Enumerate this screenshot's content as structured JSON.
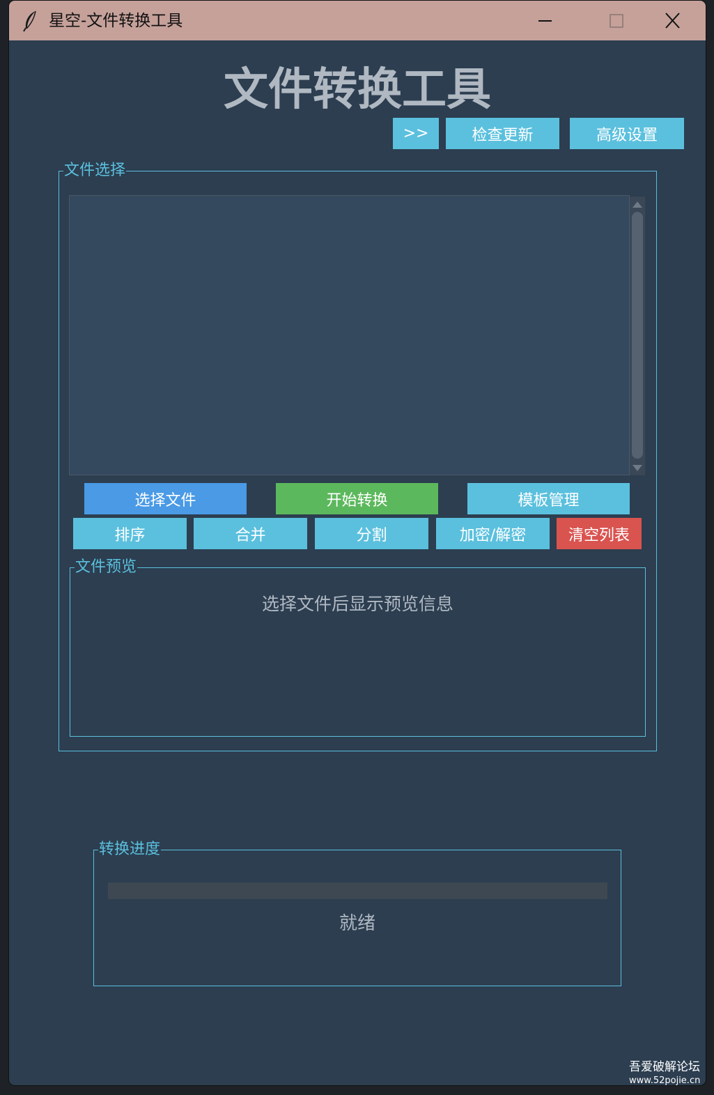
{
  "window": {
    "title": "星空-文件转换工具"
  },
  "header": {
    "title": "文件转换工具",
    "expand_label": ">>",
    "check_update_label": "检查更新",
    "advanced_settings_label": "高级设置"
  },
  "file_select": {
    "label": "文件选择",
    "files": [],
    "buttons": {
      "select_files": "选择文件",
      "start_convert": "开始转换",
      "template_manage": "模板管理",
      "sort": "排序",
      "merge": "合并",
      "split": "分割",
      "encrypt_decrypt": "加密/解密",
      "clear_list": "清空列表"
    }
  },
  "preview": {
    "label": "文件预览",
    "placeholder": "选择文件后显示预览信息"
  },
  "progress": {
    "label": "转换进度",
    "value": 0,
    "status": "就绪"
  },
  "watermark": {
    "line1": "吾爱破解论坛",
    "line2": "www.52pojie.cn"
  },
  "colors": {
    "window_bg": "#2c3e50",
    "titlebar_bg": "#c5a19a",
    "accent": "#5bc0de",
    "primary_blue": "#4a9ae6",
    "success_green": "#5cb85c",
    "danger_red": "#d9534f",
    "heading_text": "#b0b8c2"
  },
  "icons": {
    "app": "feather-icon",
    "minimize": "minimize-icon",
    "maximize": "maximize-icon",
    "close": "close-icon"
  }
}
